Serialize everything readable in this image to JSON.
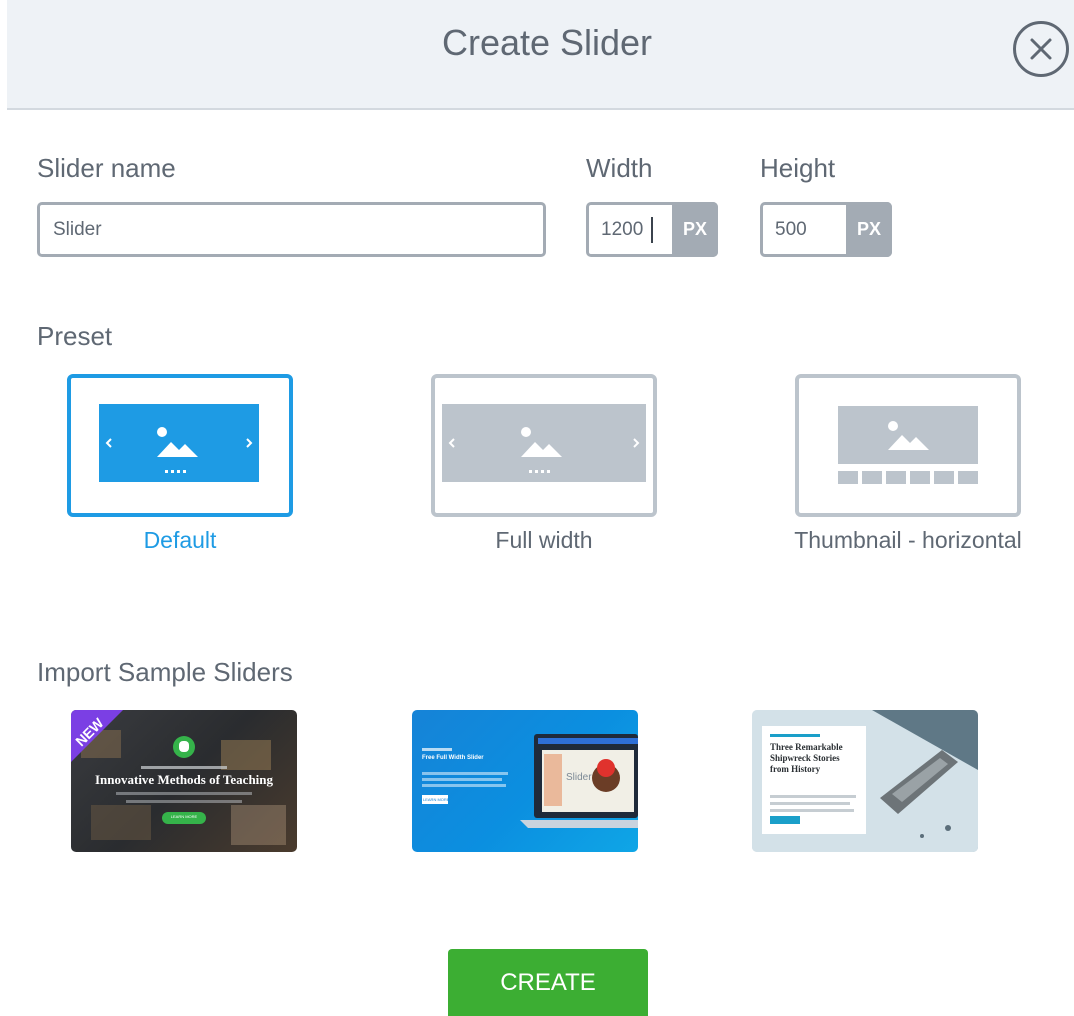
{
  "header": {
    "title": "Create Slider"
  },
  "form": {
    "name_label": "Slider name",
    "name_value": "Slider",
    "width_label": "Width",
    "width_value": "1200",
    "height_label": "Height",
    "height_value": "500",
    "unit": "PX"
  },
  "preset": {
    "label": "Preset",
    "options": [
      {
        "label": "Default",
        "selected": true
      },
      {
        "label": "Full width",
        "selected": false
      },
      {
        "label": "Thumbnail - horizontal",
        "selected": false
      }
    ]
  },
  "samples": {
    "label": "Import Sample Sliders",
    "items": [
      {
        "badge": "NEW",
        "title": "Innovative Methods of Teaching",
        "button": "LEARN MORE"
      },
      {
        "title": "Free Full Width Slider",
        "button": "LEARN MORE",
        "screen_text": "Slider"
      },
      {
        "title": "Three Remarkable Shipwreck Stories from History"
      }
    ]
  },
  "actions": {
    "create_label": "CREATE"
  },
  "colors": {
    "accent": "#1e9be4",
    "create": "#3cae33",
    "muted": "#a3abb4",
    "text": "#5f6873"
  }
}
